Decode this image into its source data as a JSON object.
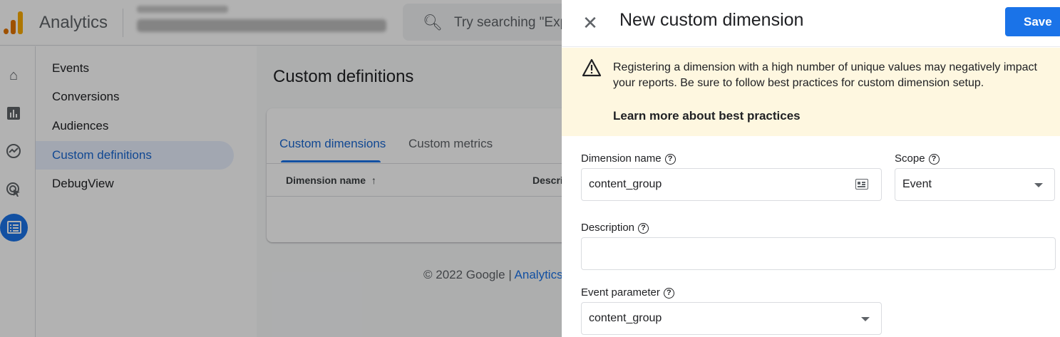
{
  "app": {
    "title": "Analytics",
    "search_placeholder": "Try searching \"Exp",
    "brand_colors": {
      "orange": "#f9ab00",
      "dark_orange": "#e37400",
      "accent": "#1a73e8"
    }
  },
  "rail": {
    "icons": [
      "home-icon",
      "reports-icon",
      "explore-icon",
      "advertising-icon",
      "configure-icon"
    ]
  },
  "subnav": {
    "items": [
      {
        "label": "Events"
      },
      {
        "label": "Conversions"
      },
      {
        "label": "Audiences"
      },
      {
        "label": "Custom definitions",
        "active": true
      },
      {
        "label": "DebugView"
      }
    ]
  },
  "main": {
    "title": "Custom definitions",
    "tabs": [
      {
        "label": "Custom dimensions",
        "active": true
      },
      {
        "label": "Custom metrics"
      }
    ],
    "table": {
      "columns": [
        "Dimension name",
        "Descri"
      ]
    },
    "footer": {
      "copyright": "© 2022 Google |",
      "link": "Analytics"
    }
  },
  "drawer": {
    "title": "New custom dimension",
    "save_label": "Save",
    "warning": {
      "text": "Registering a dimension with a high number of unique values may negatively impact your reports. Be sure to follow best practices for custom dimension setup.",
      "link": "Learn more about best practices"
    },
    "fields": {
      "dimension_name": {
        "label": "Dimension name",
        "value": "content_group"
      },
      "scope": {
        "label": "Scope",
        "value": "Event"
      },
      "description": {
        "label": "Description",
        "value": ""
      },
      "event_parameter": {
        "label": "Event parameter",
        "value": "content_group"
      }
    }
  }
}
